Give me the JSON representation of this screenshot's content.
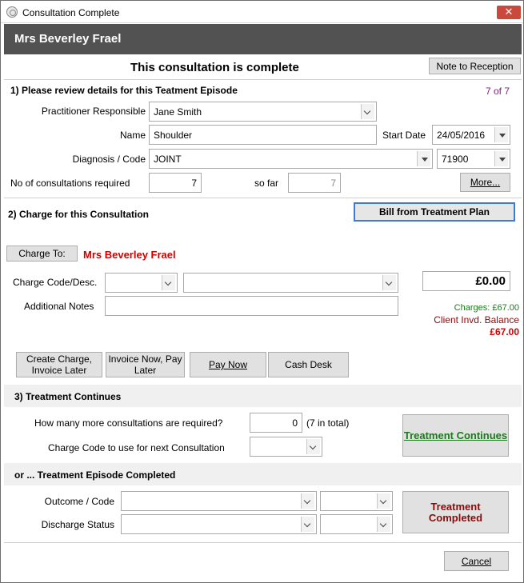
{
  "window": {
    "title": "Consultation Complete",
    "close_symbol": "✕"
  },
  "patient": {
    "name": "Mrs Beverley Frael"
  },
  "header": {
    "title": "This consultation is complete",
    "note_button": "Note to Reception"
  },
  "review": {
    "title": "1) Please review details for this Teatment Episode",
    "counter": "7 of 7",
    "practitioner_label": "Practitioner Responsible",
    "practitioner_value": "Jane Smith",
    "name_label": "Name",
    "name_value": "Shoulder",
    "start_date_label": "Start Date",
    "start_date_value": "24/05/2016",
    "diagnosis_label": "Diagnosis / Code",
    "diagnosis_value": "JOINT",
    "diagnosis_code": "71900",
    "consult_required_label": "No of consultations required",
    "consult_required_value": "7",
    "so_far_label": "so far",
    "so_far_value": "7",
    "more_button": "More..."
  },
  "charge": {
    "title": "2) Charge for this Consultation",
    "bill_button": "Bill from Treatment Plan",
    "charge_to_button": "Charge To:",
    "charge_to_name": "Mrs Beverley Frael",
    "code_label": "Charge Code/Desc.",
    "code_value": "",
    "desc_value": "",
    "amount": "£0.00",
    "notes_label": "Additional Notes",
    "notes_value": "",
    "charges_text": "Charges: £67.00",
    "balance_label": "Client Invd. Balance",
    "balance_value": "£67.00",
    "buttons": {
      "create_invoice_later": "Create Charge, Invoice Later",
      "invoice_now_pay_later": "Invoice Now, Pay Later",
      "pay_now": "Pay Now",
      "cash_desk": "Cash Desk"
    }
  },
  "continues": {
    "title": "3) Treatment Continues",
    "more_label": "How many more consultations are required?",
    "more_value": "0",
    "total_text": "(7 in total)",
    "next_code_label": "Charge Code to use for next Consultation",
    "next_code_value": "",
    "button": "Treatment Continues"
  },
  "completed": {
    "title": "or ... Treatment Episode Completed",
    "outcome_label": "Outcome / Code",
    "discharge_label": "Discharge Status",
    "button": "Treatment Completed"
  },
  "footer": {
    "cancel_button": "Cancel"
  },
  "colors": {
    "header_bg": "#525252",
    "accent_green": "#1b7a1b",
    "accent_red": "#d00000",
    "accent_maroon": "#8a0a0a",
    "close_red": "#c9493c"
  }
}
